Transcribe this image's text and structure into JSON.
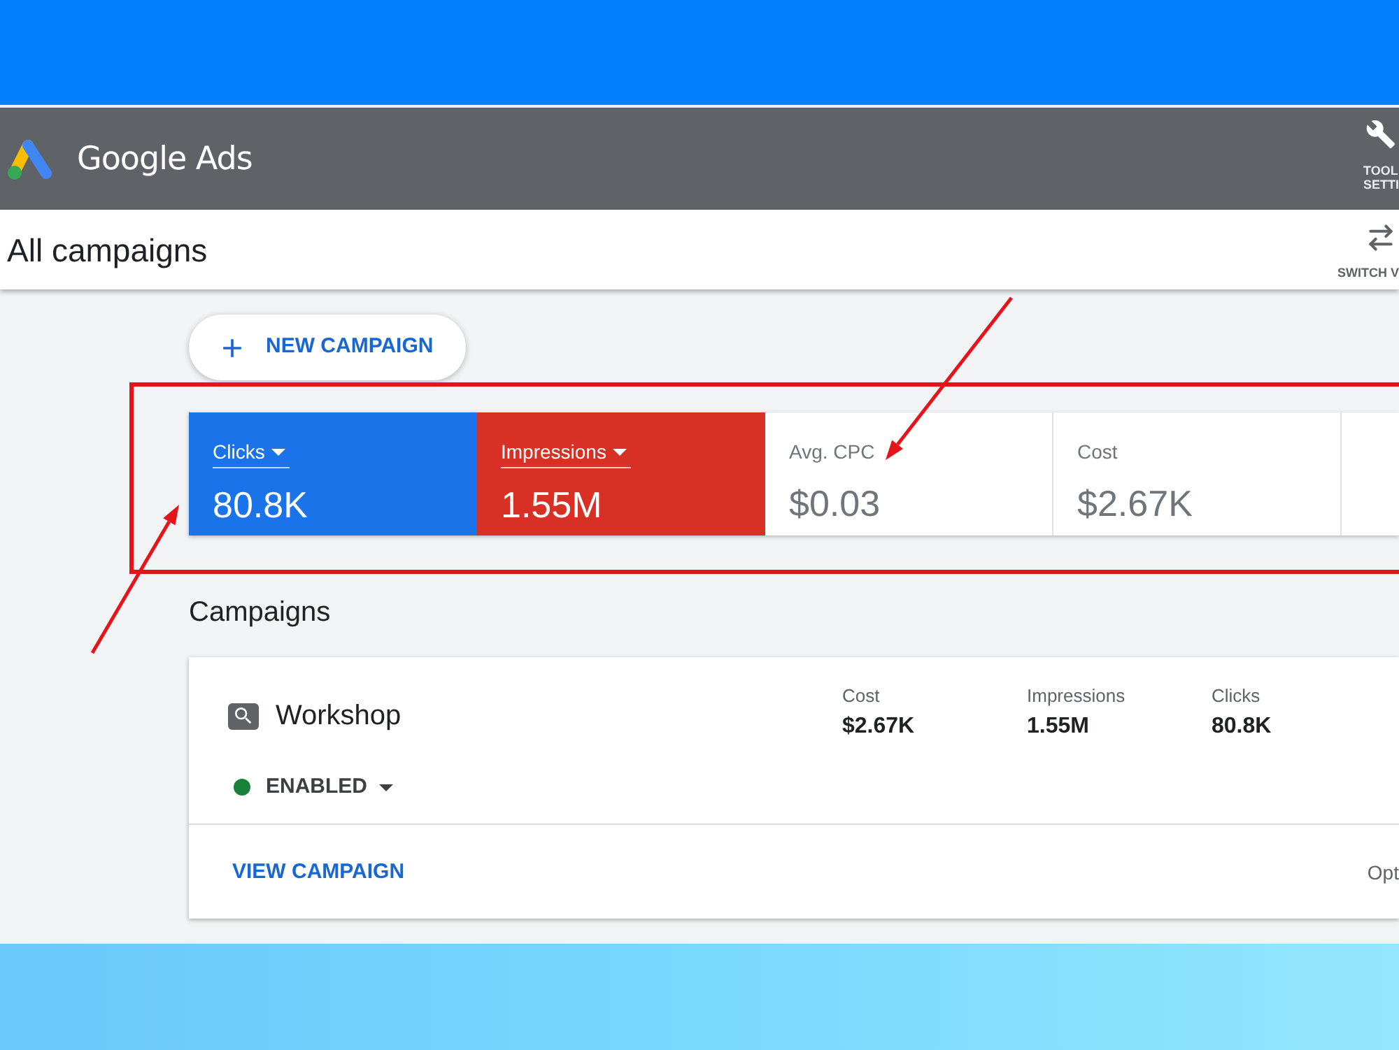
{
  "header": {
    "product_name": "Google Ads",
    "tools_label": [
      "TOOL",
      "SETTI"
    ]
  },
  "page_header": {
    "title": "All campaigns",
    "switch_view_label": "SWITCH V"
  },
  "new_campaign_button": {
    "label": "NEW CAMPAIGN"
  },
  "metrics": [
    {
      "label": "Clicks",
      "value": "80.8K",
      "selected": true,
      "color": "#1a73e8"
    },
    {
      "label": "Impressions",
      "value": "1.55M",
      "selected": true,
      "color": "#d93025"
    },
    {
      "label": "Avg. CPC",
      "value": "$0.03",
      "selected": false
    },
    {
      "label": "Cost",
      "value": "$2.67K",
      "selected": false
    }
  ],
  "campaigns": {
    "heading": "Campaigns",
    "items": [
      {
        "name": "Workshop",
        "status": {
          "label": "ENABLED",
          "color": "#188038"
        },
        "stats": [
          {
            "label": "Cost",
            "value": "$2.67K"
          },
          {
            "label": "Impressions",
            "value": "1.55M"
          },
          {
            "label": "Clicks",
            "value": "80.8K"
          }
        ],
        "view_link": "VIEW CAMPAIGN",
        "footer_right": "Opt"
      }
    ]
  }
}
